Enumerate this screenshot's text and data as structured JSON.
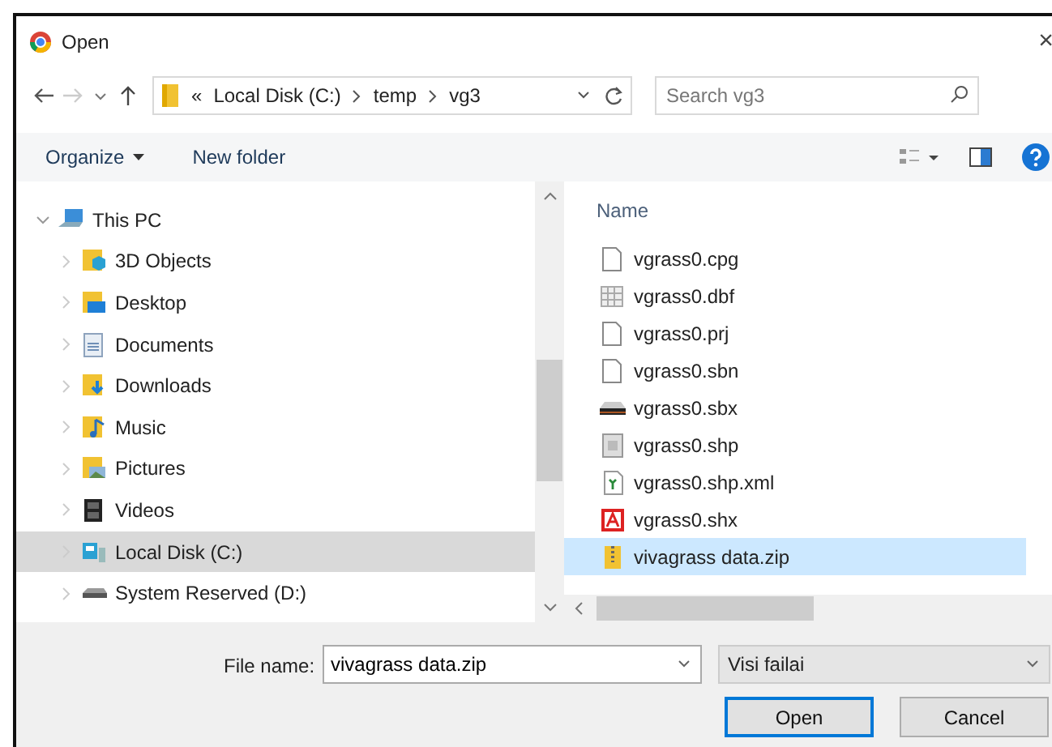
{
  "window": {
    "title": "Open",
    "close": "×"
  },
  "address": {
    "prefix": "«",
    "breadcrumbs": [
      "Local Disk (C:)",
      "temp",
      "vg3"
    ]
  },
  "search": {
    "placeholder": "Search vg3"
  },
  "toolbar": {
    "organize": "Organize",
    "new_folder": "New folder"
  },
  "navigation": [
    {
      "label": "This PC",
      "kind": "pc",
      "expanded": true,
      "selected": false,
      "children": [
        {
          "label": "3D Objects",
          "kind": "objects",
          "expanded": false,
          "selected": false
        },
        {
          "label": "Desktop",
          "kind": "desktop",
          "expanded": false,
          "selected": false
        },
        {
          "label": "Documents",
          "kind": "documents",
          "expanded": false,
          "selected": false
        },
        {
          "label": "Downloads",
          "kind": "downloads",
          "expanded": false,
          "selected": false
        },
        {
          "label": "Music",
          "kind": "music",
          "expanded": false,
          "selected": false
        },
        {
          "label": "Pictures",
          "kind": "pictures",
          "expanded": false,
          "selected": false
        },
        {
          "label": "Videos",
          "kind": "videos",
          "expanded": false,
          "selected": false
        },
        {
          "label": "Local Disk (C:)",
          "kind": "disk",
          "expanded": false,
          "selected": true
        },
        {
          "label": "System Reserved (D:)",
          "kind": "drive",
          "expanded": false,
          "selected": false
        }
      ]
    }
  ],
  "files": {
    "columns": [
      "Name"
    ],
    "rows": [
      {
        "name": "vgrass0.cpg",
        "kind": "blank",
        "selected": false
      },
      {
        "name": "vgrass0.dbf",
        "kind": "table",
        "selected": false
      },
      {
        "name": "vgrass0.prj",
        "kind": "blank",
        "selected": false
      },
      {
        "name": "vgrass0.sbn",
        "kind": "blank",
        "selected": false
      },
      {
        "name": "vgrass0.sbx",
        "kind": "sbx",
        "selected": false
      },
      {
        "name": "vgrass0.shp",
        "kind": "generic",
        "selected": false
      },
      {
        "name": "vgrass0.shp.xml",
        "kind": "xml",
        "selected": false
      },
      {
        "name": "vgrass0.shx",
        "kind": "acad",
        "selected": false
      },
      {
        "name": "vivagrass data.zip",
        "kind": "zip",
        "selected": true
      }
    ]
  },
  "footer": {
    "file_name_label": "File name:",
    "file_name_value": "vivagrass data.zip",
    "filter": "Visi failai",
    "buttons": [
      {
        "label": "Open",
        "default": true
      },
      {
        "label": "Cancel",
        "default": false
      }
    ]
  }
}
